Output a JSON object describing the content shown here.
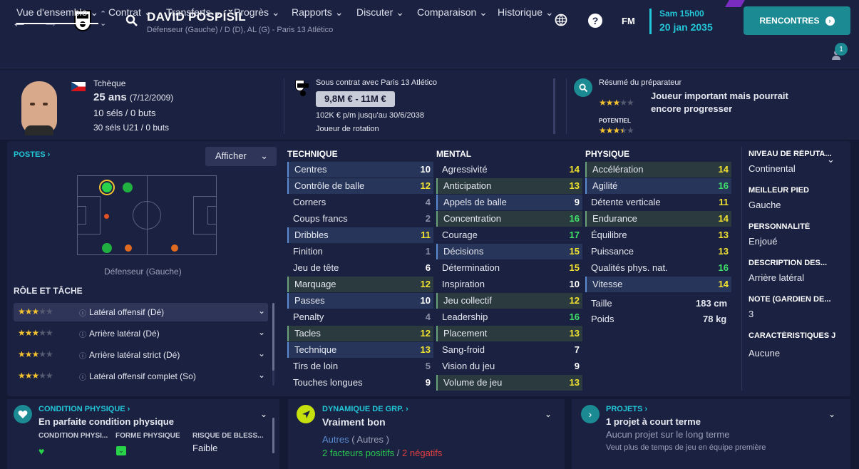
{
  "header": {
    "back_icon": "←",
    "forward_icon": "→",
    "player_name": "DAVID POSPÍŠIL",
    "player_sub": "Défenseur (Gauche) / D (D), AL (G) - Paris 13 Atlético",
    "fm_label": "FM",
    "date_line1": "Sam 15h00",
    "date_line2": "20 jan 2035",
    "rencontres_label": "RENCONTRES",
    "notif_count": "1",
    "accent": "#22c7d8"
  },
  "menu": [
    "Vue d'ensemble",
    "Contrat",
    "Transferts",
    "Progrès",
    "Rapports",
    "Discuter",
    "Comparaison",
    "Historique"
  ],
  "info": {
    "nationality": "Tchèque",
    "age": "25 ans",
    "dob": "(7/12/2009)",
    "caps": "10 séls / 0 buts",
    "u21": "30 séls U21 / 0 buts",
    "contract": "Sous contrat avec Paris 13 Atlético",
    "value": "9,8M € - 11M €",
    "wage": "102K € p/m jusqu'au 30/6/2038",
    "status": "Joueur de rotation",
    "coach_title": "Résumé du préparateur",
    "coach_text": "Joueur important mais pourrait encore progresser",
    "potential_label": "POTENTIEL"
  },
  "positions": {
    "title": "POSTES",
    "show_label": "Afficher",
    "position_label": "Défenseur (Gauche)",
    "role_title": "RÔLE ET TÂCHE",
    "roles": [
      {
        "name": "Latéral offensif (Dé)"
      },
      {
        "name": "Arrière latéral (Dé)"
      },
      {
        "name": "Arrière latéral strict (Dé)"
      },
      {
        "name": "Latéral offensif complet (So)"
      }
    ]
  },
  "technique": {
    "title": "TECHNIQUE",
    "items": [
      {
        "name": "Centres",
        "value": "10"
      },
      {
        "name": "Contrôle de balle",
        "value": "12"
      },
      {
        "name": "Corners",
        "value": "4"
      },
      {
        "name": "Coups francs",
        "value": "2"
      },
      {
        "name": "Dribbles",
        "value": "11"
      },
      {
        "name": "Finition",
        "value": "1"
      },
      {
        "name": "Jeu de tête",
        "value": "6"
      },
      {
        "name": "Marquage",
        "value": "12"
      },
      {
        "name": "Passes",
        "value": "10"
      },
      {
        "name": "Penalty",
        "value": "4"
      },
      {
        "name": "Tacles",
        "value": "12"
      },
      {
        "name": "Technique",
        "value": "13"
      },
      {
        "name": "Tirs de loin",
        "value": "5"
      },
      {
        "name": "Touches longues",
        "value": "9"
      }
    ]
  },
  "mental": {
    "title": "MENTAL",
    "items": [
      {
        "name": "Agressivité",
        "value": "14"
      },
      {
        "name": "Anticipation",
        "value": "13"
      },
      {
        "name": "Appels de balle",
        "value": "9"
      },
      {
        "name": "Concentration",
        "value": "16"
      },
      {
        "name": "Courage",
        "value": "17"
      },
      {
        "name": "Décisions",
        "value": "15"
      },
      {
        "name": "Détermination",
        "value": "15"
      },
      {
        "name": "Inspiration",
        "value": "10"
      },
      {
        "name": "Jeu collectif",
        "value": "12"
      },
      {
        "name": "Leadership",
        "value": "16"
      },
      {
        "name": "Placement",
        "value": "13"
      },
      {
        "name": "Sang-froid",
        "value": "7"
      },
      {
        "name": "Vision du jeu",
        "value": "9"
      },
      {
        "name": "Volume de jeu",
        "value": "13"
      }
    ]
  },
  "physique": {
    "title": "PHYSIQUE",
    "items": [
      {
        "name": "Accélération",
        "value": "14"
      },
      {
        "name": "Agilité",
        "value": "16"
      },
      {
        "name": "Détente verticale",
        "value": "11"
      },
      {
        "name": "Endurance",
        "value": "14"
      },
      {
        "name": "Équilibre",
        "value": "13"
      },
      {
        "name": "Puissance",
        "value": "13"
      },
      {
        "name": "Qualités phys. nat.",
        "value": "16"
      },
      {
        "name": "Vitesse",
        "value": "14"
      }
    ],
    "height_label": "Taille",
    "height": "183 cm",
    "weight_label": "Poids",
    "weight": "78 kg"
  },
  "side": [
    {
      "title": "NIVEAU DE RÉPUTA...",
      "value": "Continental"
    },
    {
      "title": "MEILLEUR PIED",
      "value": "Gauche"
    },
    {
      "title": "PERSONNALITÉ",
      "value": "Enjoué"
    },
    {
      "title": "DESCRIPTION DES...",
      "value": "Arrière latéral"
    },
    {
      "title": "NOTE (GARDIEN DE...",
      "value": "3"
    },
    {
      "title": "CARACTÉRISTIQUES J",
      "value": "Aucune"
    }
  ],
  "bottom": {
    "condition_title": "CONDITION PHYSIQUE",
    "condition_text": "En parfaite condition physique",
    "cond_col1": "CONDITION PHYSI...",
    "cond_col2": "FORME PHYSIQUE",
    "cond_col3": "RISQUE DE BLESS...",
    "injury_risk": "Faible",
    "dyn_title": "DYNAMIQUE DE GRP.",
    "dyn_text": "Vraiment bon",
    "dyn_group": "Autres",
    "dyn_group2": "( Autres )",
    "dyn_pos": "2 facteurs positifs",
    "dyn_sep": "/",
    "dyn_neg": "2 négatifs",
    "proj_title": "PROJETS",
    "proj_text": "1 projet à court terme",
    "proj_line2": "Aucun projet sur le long terme",
    "proj_line3": "Veut plus de temps de jeu en équipe première"
  }
}
